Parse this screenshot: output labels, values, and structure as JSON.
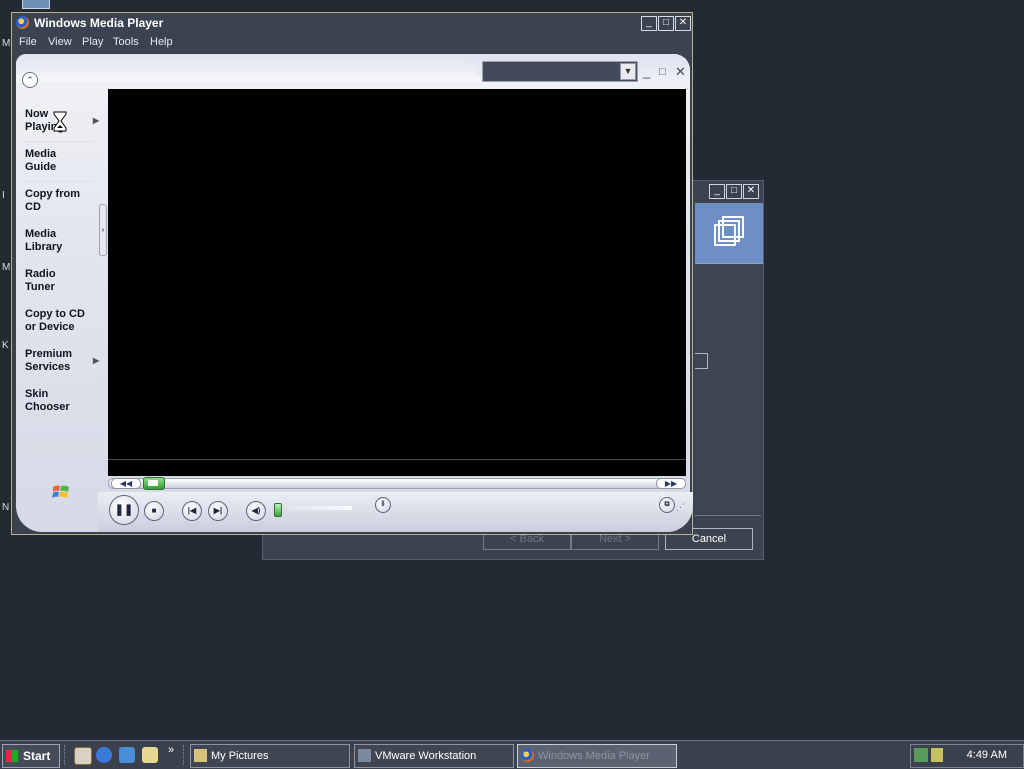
{
  "desktop": {
    "letters": [
      "M",
      "I",
      "M",
      "K",
      "N"
    ]
  },
  "wizard": {
    "back_label": "< Back",
    "next_label": "Next >",
    "cancel_label": "Cancel"
  },
  "wmp": {
    "title": "Windows Media Player",
    "menus": [
      "File",
      "View",
      "Play",
      "Tools",
      "Help"
    ],
    "nav_items": [
      {
        "label": "Now\nPlaying",
        "has_arrow": true
      },
      {
        "label": "Media\nGuide",
        "has_arrow": false
      },
      {
        "label": "Copy from\nCD",
        "has_arrow": false
      },
      {
        "label": "Media\nLibrary",
        "has_arrow": false
      },
      {
        "label": "Radio\nTuner",
        "has_arrow": false
      },
      {
        "label": "Copy to CD\nor Device",
        "has_arrow": false
      },
      {
        "label": "Premium\nServices",
        "has_arrow": true
      },
      {
        "label": "Skin\nChooser",
        "has_arrow": false
      }
    ],
    "playlist_combo_value": "",
    "state": "playing"
  },
  "taskbar": {
    "start_label": "Start",
    "buttons": [
      {
        "label": "My Pictures",
        "active": false
      },
      {
        "label": "VMware Workstation",
        "active": false
      },
      {
        "label": "Windows Media Player",
        "active": true
      }
    ],
    "clock": "4:49 AM"
  },
  "colors": {
    "desktop": "#232a33",
    "window": "#3c4350",
    "skin_light": "#eef0f6",
    "video": "#000000",
    "seek_thumb": "#2e9e35"
  }
}
